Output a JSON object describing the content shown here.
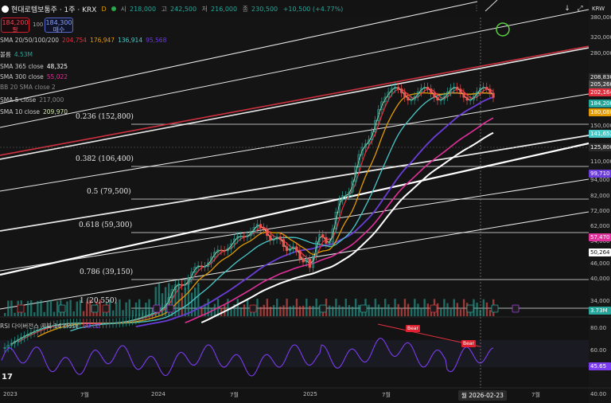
{
  "header": {
    "symbol": "현대로템보통주 · 1주 · KRX",
    "badge_d": "D",
    "open_label": "시",
    "open": "218,000",
    "high_label": "고",
    "high": "242,500",
    "low_label": "저",
    "low": "216,000",
    "close_label": "종",
    "close": "230,500",
    "change": "+10,500 (+4.77%)"
  },
  "trade": {
    "sell_price": "184,200",
    "sell_label": "팔",
    "spread": "100",
    "buy_price": "184,300",
    "buy_label": "매수"
  },
  "indicators": [
    {
      "label": "SMA 20/50/100/200",
      "values": [
        {
          "v": "204,754",
          "color": "#e0303e"
        },
        {
          "v": "176,947",
          "color": "#e39a00"
        },
        {
          "v": "136,914",
          "color": "#48c8c8"
        },
        {
          "v": "95,568",
          "color": "#6a3cd8"
        }
      ]
    },
    {
      "label": "볼륨",
      "values": [
        {
          "v": "4.53M",
          "color": "#26a69a"
        }
      ]
    },
    {
      "label": "SMA 365 close",
      "values": [
        {
          "v": "48,325",
          "color": "#ffffff"
        }
      ]
    },
    {
      "label": "SMA 300 close",
      "values": [
        {
          "v": "55,022",
          "color": "#e0309a"
        }
      ]
    },
    {
      "label": "BB 20 SMA close 2",
      "values": []
    },
    {
      "label": "SMA 5 close",
      "values": [
        {
          "v": "217,000",
          "color": "#888888"
        }
      ]
    },
    {
      "label": "SMA 10 close",
      "values": [
        {
          "v": "209,970",
          "color": "#d4e8b0"
        }
      ]
    }
  ],
  "fib_levels": [
    {
      "label": "0.236 (152,800)",
      "price": 152800
    },
    {
      "label": "0.382 (106,400)",
      "price": 106400
    },
    {
      "label": "0.5 (79,500)",
      "price": 79500
    },
    {
      "label": "0.618 (59,300)",
      "price": 59300
    },
    {
      "label": "0.786 (39,150)",
      "price": 39150
    },
    {
      "label": "1 (20,550)",
      "price": 20550
    }
  ],
  "price_axis": {
    "currency": "KRW",
    "ticks": [
      "380,000",
      "320,000",
      "280,000",
      "150,000",
      "110,000",
      "94,000",
      "82,000",
      "72,000",
      "62,000",
      "54,000",
      "46,000",
      "40,000",
      "34,000"
    ],
    "tags": [
      {
        "label": "208,830",
        "color": "#2a2a2a"
      },
      {
        "label": "205,260",
        "color": "#444444"
      },
      {
        "label": "202,164",
        "color": "#e0303e"
      },
      {
        "label": "184,200",
        "color": "#26a69a"
      },
      {
        "label": "180,080",
        "color": "#e39a00"
      },
      {
        "label": "141,652",
        "color": "#48c8c8"
      },
      {
        "label": "125,800",
        "color": "#2a2a2a"
      },
      {
        "label": "99,710",
        "color": "#6a3cd8"
      },
      {
        "label": "57,470",
        "color": "#e0309a"
      },
      {
        "label": "50,264",
        "color": "#ffffff"
      },
      {
        "label": "3.73M",
        "color": "#26a69a"
      }
    ]
  },
  "rsi": {
    "label": "RSI 다이버전스 지표 14 close",
    "value": "59.82",
    "last": "45.65",
    "ticks": [
      "80.00",
      "60.00",
      "40.00"
    ],
    "bear_label": "Bear"
  },
  "time_axis": {
    "labels": [
      "2023",
      "7월",
      "2024",
      "7월",
      "2025",
      "7월",
      "7월"
    ],
    "crosshair_date": "월 2026-02-23"
  },
  "colors": {
    "bg": "#131313",
    "sma20": "#e0303e",
    "sma50": "#e39a00",
    "sma100": "#48c8c8",
    "sma200": "#6a3cd8",
    "sma300": "#e0309a",
    "sma365": "#ffffff",
    "sma10": "#d4e8b0",
    "up": "#26a69a",
    "down": "#ef5350",
    "rsi": "#7b3cf0",
    "channel": "#ffffff",
    "resistance": "#d0303e"
  },
  "icons": [
    "logo-icon",
    "live-dot-icon",
    "dots-menu-icon",
    "expand-icon",
    "collapse-icon",
    "download-icon",
    "fullscreen-icon",
    "plus-circle-icon",
    "tradingview-logo-icon"
  ]
}
